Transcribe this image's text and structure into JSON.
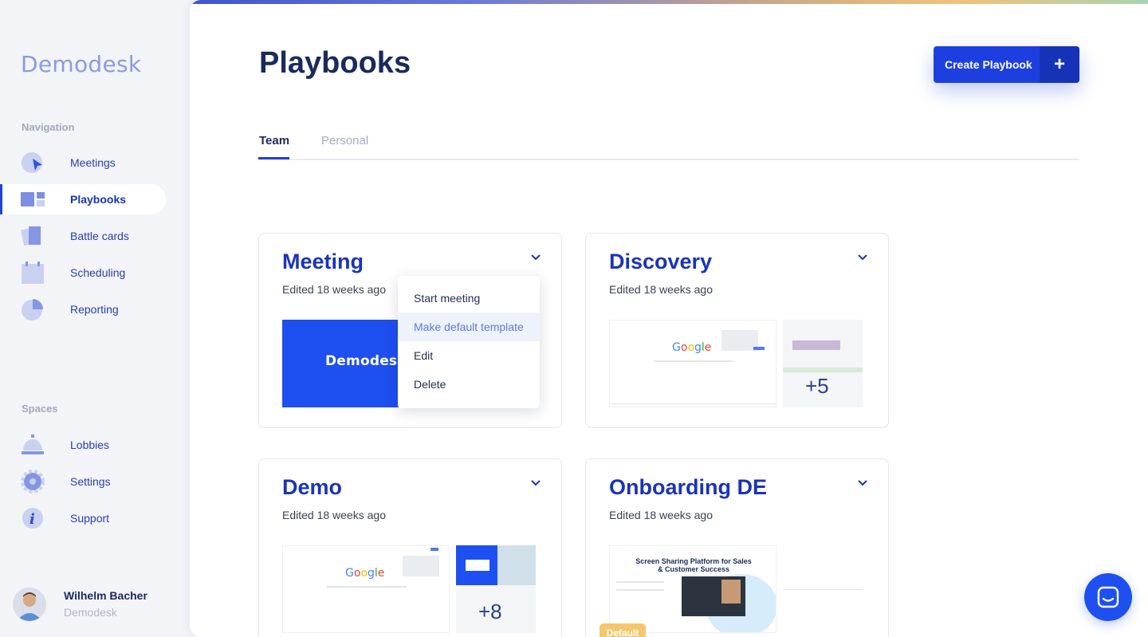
{
  "sidebar": {
    "logo": "Demodesk",
    "nav_section": "Navigation",
    "nav_items": [
      {
        "label": "Meetings",
        "icon": "meetings-icon"
      },
      {
        "label": "Playbooks",
        "icon": "playbooks-icon",
        "active": true
      },
      {
        "label": "Battle cards",
        "icon": "battle-cards-icon"
      },
      {
        "label": "Scheduling",
        "icon": "calendar-icon"
      },
      {
        "label": "Reporting",
        "icon": "pie-chart-icon"
      }
    ],
    "spaces_section": "Spaces",
    "space_items": [
      {
        "label": "Lobbies",
        "icon": "bell-icon"
      },
      {
        "label": "Settings",
        "icon": "gear-icon"
      },
      {
        "label": "Support",
        "icon": "info-icon"
      }
    ],
    "user": {
      "name": "Wilhelm Bacher",
      "org": "Demodesk"
    }
  },
  "header": {
    "title": "Playbooks",
    "create_label": "Create Playbook",
    "create_plus": "+"
  },
  "tabs": [
    {
      "label": "Team",
      "active": true
    },
    {
      "label": "Personal",
      "active": false
    }
  ],
  "cards": [
    {
      "title": "Meeting",
      "subtitle": "Edited 18 weeks ago",
      "thumb_text": "Demodesk"
    },
    {
      "title": "Discovery",
      "subtitle": "Edited 18 weeks ago",
      "extra_count": "+5"
    },
    {
      "title": "Demo",
      "subtitle": "Edited 18 weeks ago",
      "extra_count": "+8"
    },
    {
      "title": "Onboarding DE",
      "subtitle": "Edited 18 weeks ago",
      "badge": "Default",
      "thumb_heading": "Screen Sharing Platform for Sales & Customer Success"
    }
  ],
  "google_logo": [
    "G",
    "o",
    "o",
    "g",
    "l",
    "e"
  ],
  "menu": {
    "items": [
      "Start meeting",
      "Make default template",
      "Edit",
      "Delete"
    ],
    "hovered_index": 1
  },
  "colors": {
    "accent": "#1e3fe0",
    "title_blue": "#1a34b8",
    "sidebar_bg": "#f2f4f8"
  }
}
